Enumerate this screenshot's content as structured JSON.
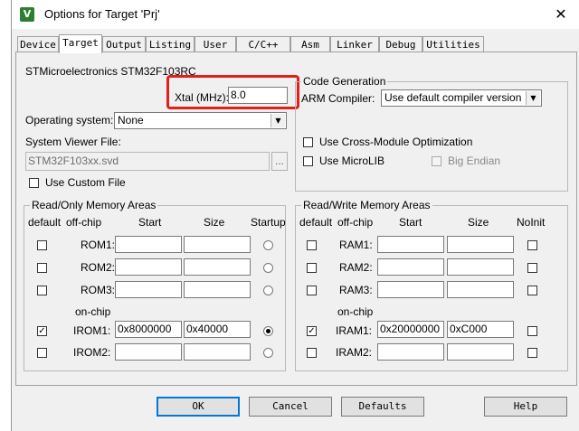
{
  "window": {
    "title": "Options for Target 'Prj'",
    "icon": "uvision-icon",
    "close_glyph": "✕"
  },
  "tabs": [
    {
      "label": "Device"
    },
    {
      "label": "Target"
    },
    {
      "label": "Output"
    },
    {
      "label": "Listing"
    },
    {
      "label": "User"
    },
    {
      "label": "C/C++"
    },
    {
      "label": "Asm"
    },
    {
      "label": "Linker"
    },
    {
      "label": "Debug"
    },
    {
      "label": "Utilities"
    }
  ],
  "active_tab": "Target",
  "device_name": "STMicroelectronics STM32F103RC",
  "xtal": {
    "label": "Xtal (MHz):",
    "value": "8.0"
  },
  "os": {
    "label": "Operating system:",
    "value": "None"
  },
  "svd": {
    "label": "System Viewer File:",
    "value": "STM32F103xx.svd",
    "browse": "..."
  },
  "custom_file": {
    "label": "Use Custom File",
    "checked": false
  },
  "code_gen": {
    "title": "Code Generation",
    "compiler_label": "ARM Compiler:",
    "compiler_value": "Use default compiler version",
    "cross_module": "Use Cross-Module Optimization",
    "microlib": "Use MicroLIB",
    "big_endian": "Big Endian"
  },
  "ro_mem": {
    "title": "Read/Only Memory Areas",
    "headers": {
      "default": "default",
      "offchip": "off-chip",
      "start": "Start",
      "size": "Size",
      "startup": "Startup"
    },
    "onchip_label": "on-chip",
    "rows": [
      {
        "name": "ROM1:",
        "start": "",
        "size": "",
        "default": false,
        "startup": false
      },
      {
        "name": "ROM2:",
        "start": "",
        "size": "",
        "default": false,
        "startup": false
      },
      {
        "name": "ROM3:",
        "start": "",
        "size": "",
        "default": false,
        "startup": false
      },
      {
        "name": "IROM1:",
        "start": "0x8000000",
        "size": "0x40000",
        "default": true,
        "startup": true
      },
      {
        "name": "IROM2:",
        "start": "",
        "size": "",
        "default": false,
        "startup": false
      }
    ]
  },
  "rw_mem": {
    "title": "Read/Write Memory Areas",
    "headers": {
      "default": "default",
      "offchip": "off-chip",
      "start": "Start",
      "size": "Size",
      "noinit": "NoInit"
    },
    "onchip_label": "on-chip",
    "rows": [
      {
        "name": "RAM1:",
        "start": "",
        "size": "",
        "default": false
      },
      {
        "name": "RAM2:",
        "start": "",
        "size": "",
        "default": false
      },
      {
        "name": "RAM3:",
        "start": "",
        "size": "",
        "default": false
      },
      {
        "name": "IRAM1:",
        "start": "0x20000000",
        "size": "0xC000",
        "default": true
      },
      {
        "name": "IRAM2:",
        "start": "",
        "size": "",
        "default": false
      }
    ]
  },
  "buttons": {
    "ok": "OK",
    "cancel": "Cancel",
    "defaults": "Defaults",
    "help": "Help"
  },
  "colors": {
    "highlight": "#e0201b",
    "active_tab_bg": "#ffffff",
    "dialog_bg": "#f0f0f0"
  }
}
